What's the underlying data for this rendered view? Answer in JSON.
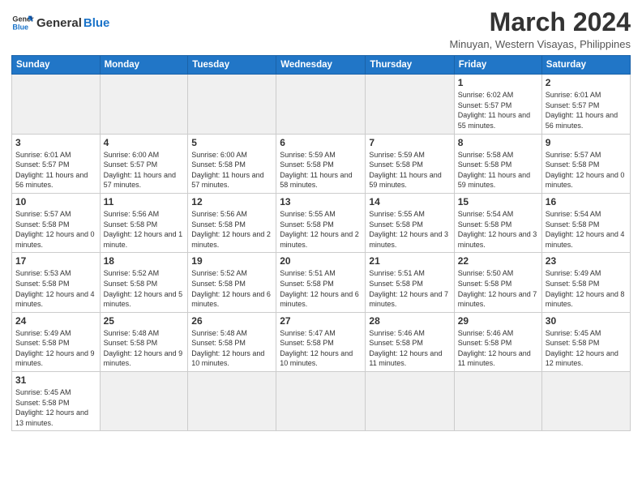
{
  "header": {
    "title": "March 2024",
    "subtitle": "Minuyan, Western Visayas, Philippines",
    "logo_line1": "General",
    "logo_line2": "Blue"
  },
  "days_of_week": [
    "Sunday",
    "Monday",
    "Tuesday",
    "Wednesday",
    "Thursday",
    "Friday",
    "Saturday"
  ],
  "weeks": [
    [
      {
        "day": "",
        "info": ""
      },
      {
        "day": "",
        "info": ""
      },
      {
        "day": "",
        "info": ""
      },
      {
        "day": "",
        "info": ""
      },
      {
        "day": "",
        "info": ""
      },
      {
        "day": "1",
        "info": "Sunrise: 6:02 AM\nSunset: 5:57 PM\nDaylight: 11 hours\nand 55 minutes."
      },
      {
        "day": "2",
        "info": "Sunrise: 6:01 AM\nSunset: 5:57 PM\nDaylight: 11 hours\nand 56 minutes."
      }
    ],
    [
      {
        "day": "3",
        "info": "Sunrise: 6:01 AM\nSunset: 5:57 PM\nDaylight: 11 hours\nand 56 minutes."
      },
      {
        "day": "4",
        "info": "Sunrise: 6:00 AM\nSunset: 5:57 PM\nDaylight: 11 hours\nand 57 minutes."
      },
      {
        "day": "5",
        "info": "Sunrise: 6:00 AM\nSunset: 5:58 PM\nDaylight: 11 hours\nand 57 minutes."
      },
      {
        "day": "6",
        "info": "Sunrise: 5:59 AM\nSunset: 5:58 PM\nDaylight: 11 hours\nand 58 minutes."
      },
      {
        "day": "7",
        "info": "Sunrise: 5:59 AM\nSunset: 5:58 PM\nDaylight: 11 hours\nand 59 minutes."
      },
      {
        "day": "8",
        "info": "Sunrise: 5:58 AM\nSunset: 5:58 PM\nDaylight: 11 hours\nand 59 minutes."
      },
      {
        "day": "9",
        "info": "Sunrise: 5:57 AM\nSunset: 5:58 PM\nDaylight: 12 hours\nand 0 minutes."
      }
    ],
    [
      {
        "day": "10",
        "info": "Sunrise: 5:57 AM\nSunset: 5:58 PM\nDaylight: 12 hours\nand 0 minutes."
      },
      {
        "day": "11",
        "info": "Sunrise: 5:56 AM\nSunset: 5:58 PM\nDaylight: 12 hours\nand 1 minute."
      },
      {
        "day": "12",
        "info": "Sunrise: 5:56 AM\nSunset: 5:58 PM\nDaylight: 12 hours\nand 2 minutes."
      },
      {
        "day": "13",
        "info": "Sunrise: 5:55 AM\nSunset: 5:58 PM\nDaylight: 12 hours\nand 2 minutes."
      },
      {
        "day": "14",
        "info": "Sunrise: 5:55 AM\nSunset: 5:58 PM\nDaylight: 12 hours\nand 3 minutes."
      },
      {
        "day": "15",
        "info": "Sunrise: 5:54 AM\nSunset: 5:58 PM\nDaylight: 12 hours\nand 3 minutes."
      },
      {
        "day": "16",
        "info": "Sunrise: 5:54 AM\nSunset: 5:58 PM\nDaylight: 12 hours\nand 4 minutes."
      }
    ],
    [
      {
        "day": "17",
        "info": "Sunrise: 5:53 AM\nSunset: 5:58 PM\nDaylight: 12 hours\nand 4 minutes."
      },
      {
        "day": "18",
        "info": "Sunrise: 5:52 AM\nSunset: 5:58 PM\nDaylight: 12 hours\nand 5 minutes."
      },
      {
        "day": "19",
        "info": "Sunrise: 5:52 AM\nSunset: 5:58 PM\nDaylight: 12 hours\nand 6 minutes."
      },
      {
        "day": "20",
        "info": "Sunrise: 5:51 AM\nSunset: 5:58 PM\nDaylight: 12 hours\nand 6 minutes."
      },
      {
        "day": "21",
        "info": "Sunrise: 5:51 AM\nSunset: 5:58 PM\nDaylight: 12 hours\nand 7 minutes."
      },
      {
        "day": "22",
        "info": "Sunrise: 5:50 AM\nSunset: 5:58 PM\nDaylight: 12 hours\nand 7 minutes."
      },
      {
        "day": "23",
        "info": "Sunrise: 5:49 AM\nSunset: 5:58 PM\nDaylight: 12 hours\nand 8 minutes."
      }
    ],
    [
      {
        "day": "24",
        "info": "Sunrise: 5:49 AM\nSunset: 5:58 PM\nDaylight: 12 hours\nand 9 minutes."
      },
      {
        "day": "25",
        "info": "Sunrise: 5:48 AM\nSunset: 5:58 PM\nDaylight: 12 hours\nand 9 minutes."
      },
      {
        "day": "26",
        "info": "Sunrise: 5:48 AM\nSunset: 5:58 PM\nDaylight: 12 hours\nand 10 minutes."
      },
      {
        "day": "27",
        "info": "Sunrise: 5:47 AM\nSunset: 5:58 PM\nDaylight: 12 hours\nand 10 minutes."
      },
      {
        "day": "28",
        "info": "Sunrise: 5:46 AM\nSunset: 5:58 PM\nDaylight: 12 hours\nand 11 minutes."
      },
      {
        "day": "29",
        "info": "Sunrise: 5:46 AM\nSunset: 5:58 PM\nDaylight: 12 hours\nand 11 minutes."
      },
      {
        "day": "30",
        "info": "Sunrise: 5:45 AM\nSunset: 5:58 PM\nDaylight: 12 hours\nand 12 minutes."
      }
    ],
    [
      {
        "day": "31",
        "info": "Sunrise: 5:45 AM\nSunset: 5:58 PM\nDaylight: 12 hours\nand 13 minutes."
      },
      {
        "day": "",
        "info": ""
      },
      {
        "day": "",
        "info": ""
      },
      {
        "day": "",
        "info": ""
      },
      {
        "day": "",
        "info": ""
      },
      {
        "day": "",
        "info": ""
      },
      {
        "day": "",
        "info": ""
      }
    ]
  ]
}
